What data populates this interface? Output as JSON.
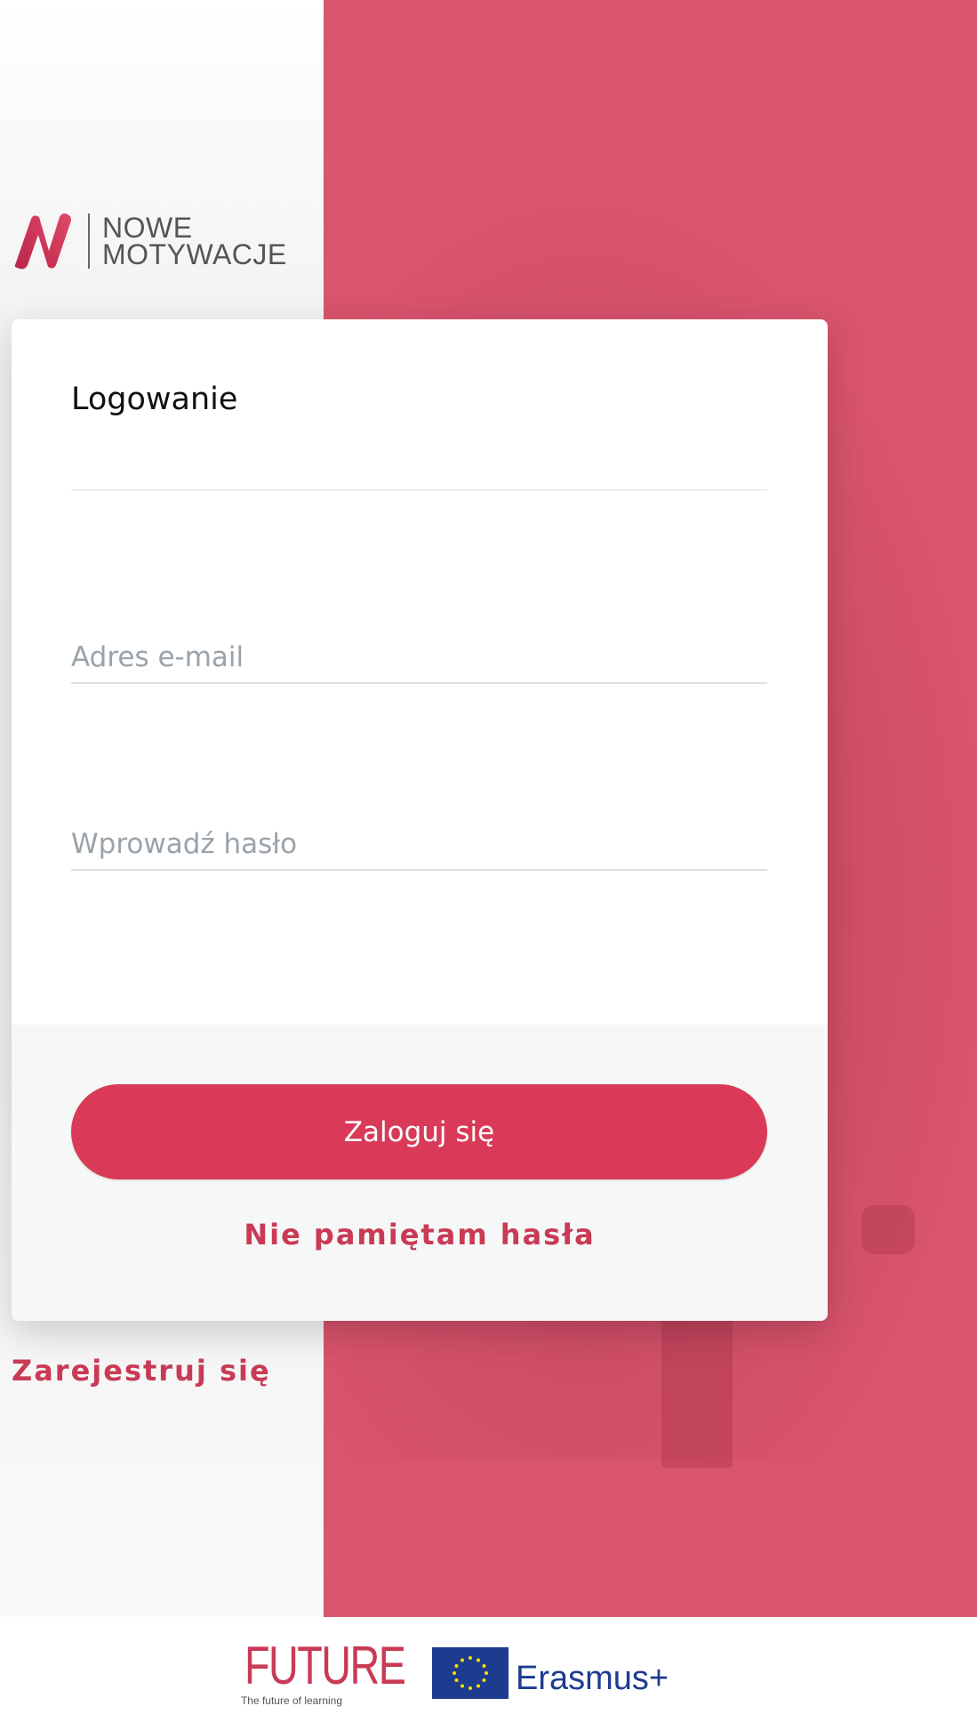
{
  "brand": {
    "name_line1": "NOWE",
    "name_line2": "MOTYWACJE",
    "accent_color": "#d93a58"
  },
  "login": {
    "title": "Logowanie",
    "email_placeholder": "Adres e-mail",
    "password_placeholder": "Wprowadź hasło",
    "submit_label": "Zaloguj się",
    "forgot_label": "Nie pamiętam hasła"
  },
  "register_label": "Zarejestruj się",
  "partners": {
    "future_word": "FUTURE",
    "future_tagline": "The future of learning",
    "erasmus_label": "Erasmus+"
  },
  "icons": {
    "brand_logo": "stylized-n-logo",
    "eu_flag": "eu-flag-icon"
  }
}
